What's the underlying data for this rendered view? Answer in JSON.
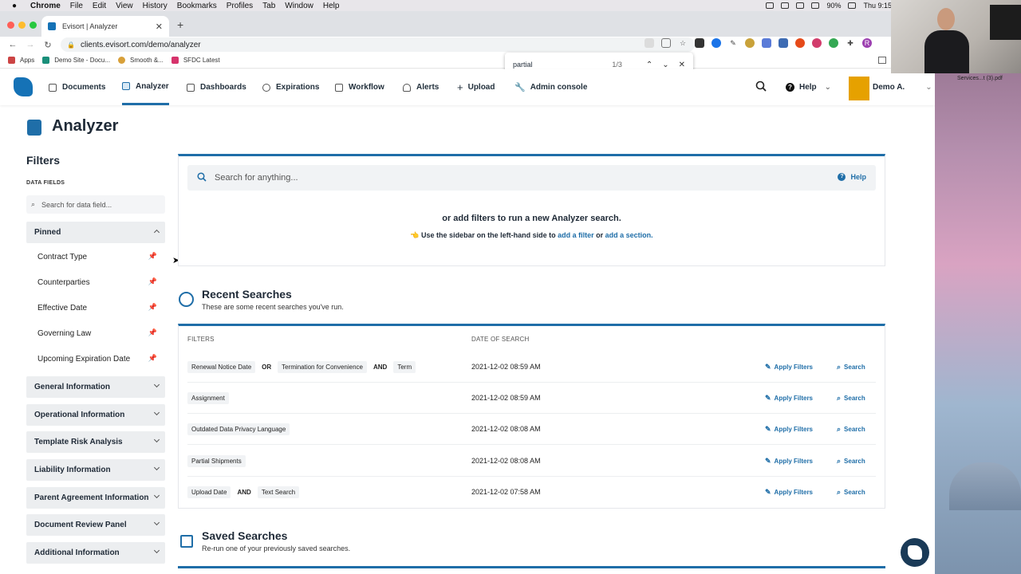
{
  "mac_menu": {
    "app": "Chrome",
    "items": [
      "File",
      "Edit",
      "View",
      "History",
      "Bookmarks",
      "Profiles",
      "Tab",
      "Window",
      "Help"
    ],
    "battery": "90%",
    "clock": "Thu 9:15"
  },
  "browser": {
    "tab_title": "Evisort | Analyzer",
    "url": "clients.evisort.com/demo/analyzer",
    "bookmarks": [
      "Apps",
      "Demo Site - Docu...",
      "Smooth &...",
      "SFDC Latest"
    ],
    "find": {
      "query": "partial",
      "count": "1/3"
    }
  },
  "nav": {
    "items": [
      "Documents",
      "Analyzer",
      "Dashboards",
      "Expirations",
      "Workflow",
      "Alerts",
      "Upload",
      "Admin console"
    ],
    "help": "Help",
    "user": "Demo A."
  },
  "page": {
    "title": "Analyzer"
  },
  "sidebar": {
    "heading": "Filters",
    "data_fields_label": "DATA FIELDS",
    "search_placeholder": "Search for data field...",
    "pinned_label": "Pinned",
    "pinned_items": [
      "Contract Type",
      "Counterparties",
      "Effective Date",
      "Governing Law",
      "Upcoming Expiration Date"
    ],
    "sections": [
      "General Information",
      "Operational Information",
      "Template Risk Analysis",
      "Liability Information",
      "Parent Agreement Information",
      "Document Review Panel",
      "Additional Information"
    ]
  },
  "search_card": {
    "placeholder": "Search for anything...",
    "help": "Help",
    "or_text": "or add filters to run a new Analyzer search.",
    "hint_prefix": "Use the sidebar on the left-hand side to",
    "hint_link1": "add a filter",
    "hint_or": "or",
    "hint_link2": "add a section."
  },
  "recent": {
    "title": "Recent Searches",
    "subtitle": "These are some recent searches you've run.",
    "col_filters": "FILTERS",
    "col_date": "DATE OF SEARCH",
    "apply_label": "Apply Filters",
    "search_label": "Search",
    "rows": [
      {
        "chips": [
          "Renewal Notice Date",
          "Termination for Convenience",
          "Term"
        ],
        "ops": [
          "OR",
          "AND"
        ],
        "date": "2021-12-02 08:59 AM"
      },
      {
        "chips": [
          "Assignment"
        ],
        "ops": [],
        "date": "2021-12-02 08:59 AM"
      },
      {
        "chips": [
          "Outdated Data Privacy Language"
        ],
        "ops": [],
        "date": "2021-12-02 08:08 AM"
      },
      {
        "chips": [
          "Partial Shipments"
        ],
        "ops": [],
        "date": "2021-12-02 08:08 AM"
      },
      {
        "chips": [
          "Upload Date",
          "Text Search"
        ],
        "ops": [
          "AND"
        ],
        "date": "2021-12-02 07:58 AM"
      }
    ]
  },
  "saved": {
    "title": "Saved Searches",
    "subtitle": "Re-run one of your previously saved searches."
  },
  "desktop": {
    "file_label": "Services...t (3).pdf"
  },
  "colors": {
    "accent": "#1f6ea8",
    "nav_text": "#22303c",
    "section_bg": "#eceef0"
  }
}
